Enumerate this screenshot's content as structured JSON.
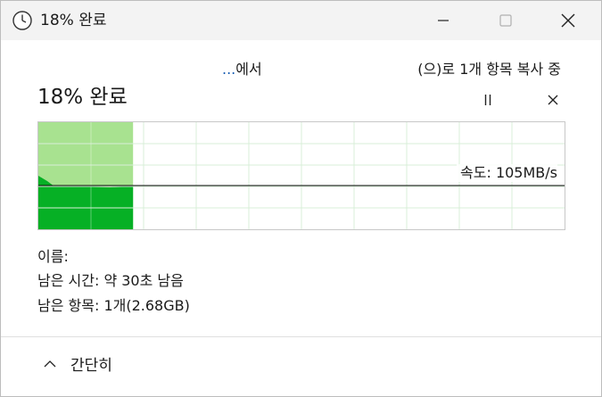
{
  "window": {
    "title": "18% 완료",
    "icon": "clock-icon",
    "controls": [
      "minimize-icon",
      "maximize-icon",
      "close-icon"
    ]
  },
  "transfer": {
    "source_ellipsis": "...",
    "source_suffix": "에서",
    "destination_text": "(으)로 1개 항목 복사 중"
  },
  "progress": {
    "title": "18% 완료",
    "percent": 18,
    "pause_icon": "pause-icon",
    "cancel_icon": "close-icon"
  },
  "graph": {
    "speed_label": "속도: 105MB/s",
    "colors": {
      "done_light": "#a8e290",
      "done_dark": "#06b025",
      "grid": "#d8efd8",
      "line": "#000000"
    }
  },
  "details": {
    "name_label": "이름:",
    "time_remaining": "남은 시간: 약 30초 남음",
    "items_remaining": "남은 항목: 1개(2.68GB)"
  },
  "footer": {
    "collapse_label": "간단히",
    "collapse_icon": "chevron-up-icon"
  }
}
